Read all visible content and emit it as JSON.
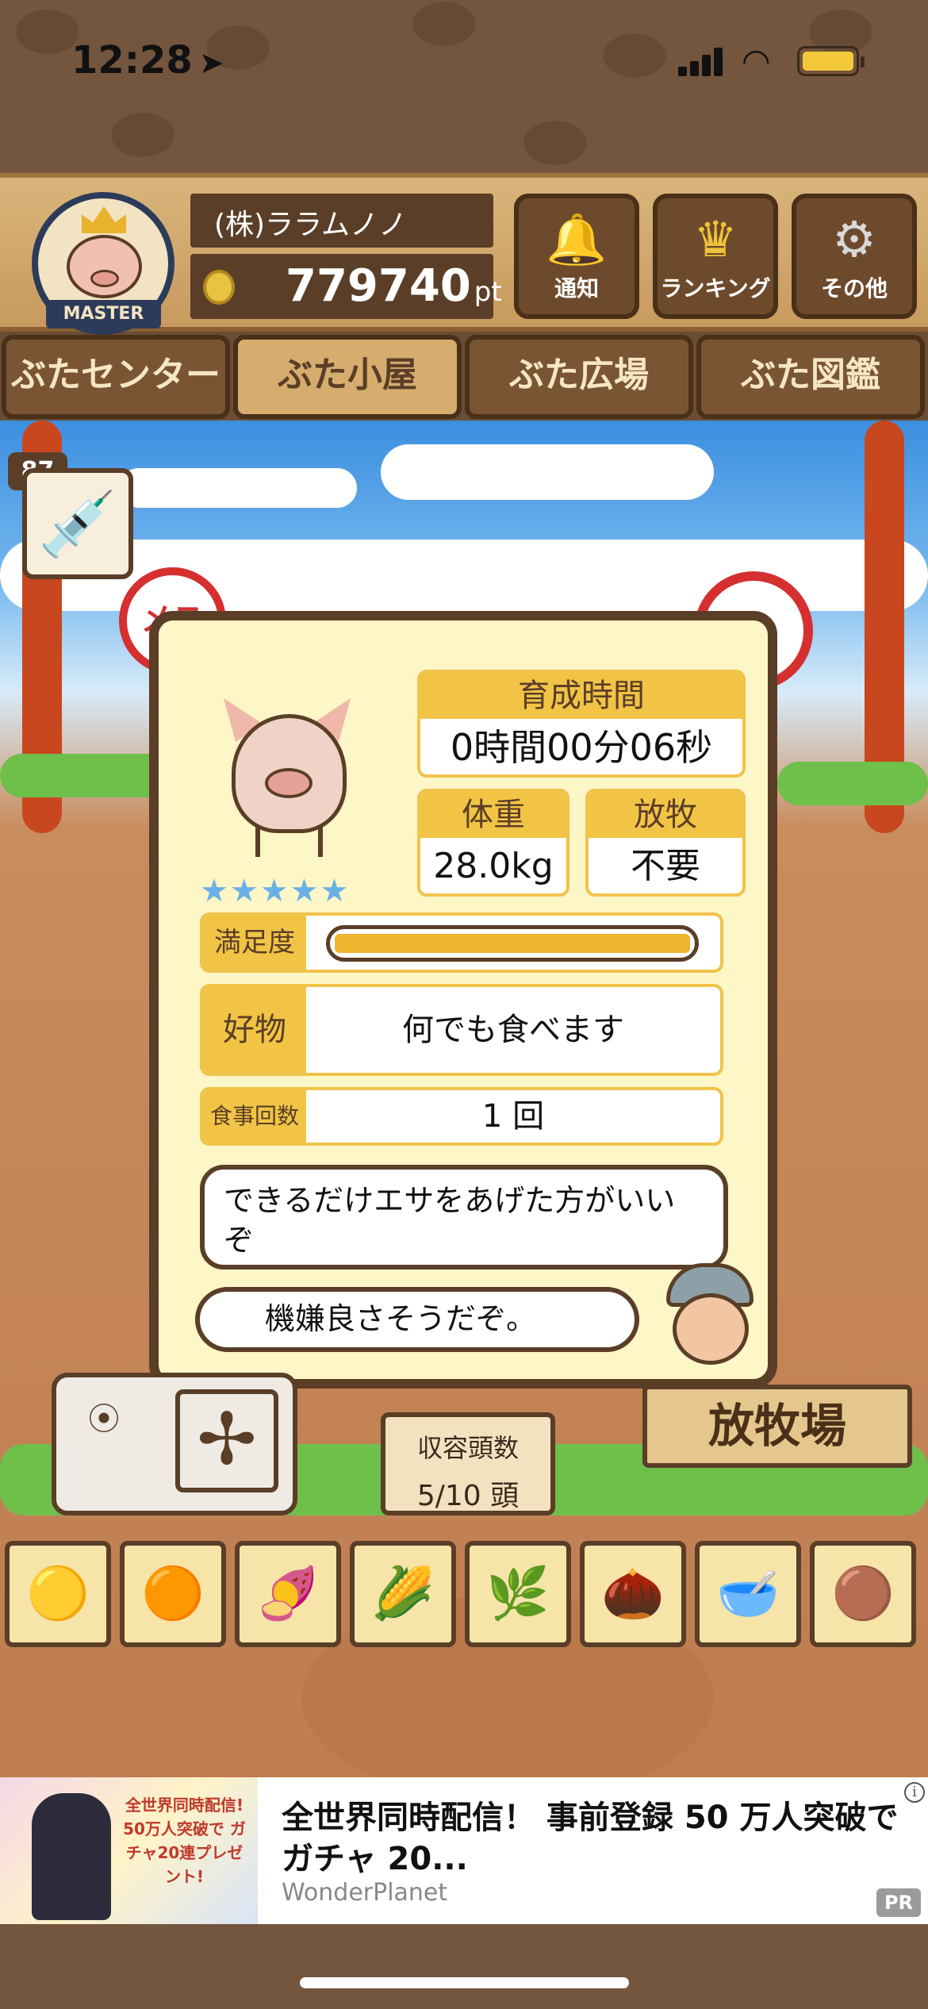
{
  "status": {
    "time": "12:28",
    "location_icon": "location-arrow-icon"
  },
  "header": {
    "badge_label": "MASTER",
    "company_name": "(株)ララムノノ",
    "points": "779740",
    "points_unit": "pt",
    "buttons": [
      {
        "label": "通知",
        "icon": "bell-icon"
      },
      {
        "label": "ランキング",
        "icon": "crown-icon"
      },
      {
        "label": "その他",
        "icon": "gear-icon"
      }
    ]
  },
  "tabs": [
    {
      "label": "ぶたセンター",
      "active": false
    },
    {
      "label": "ぶた小屋",
      "active": true
    },
    {
      "label": "ぶた広場",
      "active": false
    },
    {
      "label": "ぶた図鑑",
      "active": false
    }
  ],
  "syringe_count": "87",
  "sex_label": "メス",
  "pig": {
    "stars": "★★★★★",
    "rearing_time_header": "育成時間",
    "rearing_time_value": "0時間00分06秒",
    "weight_header": "体重",
    "weight_value": "28.0kg",
    "grazing_header": "放牧",
    "grazing_value": "不要",
    "satisfaction_label": "満足度",
    "satisfaction_level": 1.0,
    "favorite_label": "好物",
    "favorite_value": "何でも食べます",
    "meals_label": "食事回数",
    "meals_value": "1 回",
    "advice": "できるだけエサをあげた方がいいぞ",
    "mood": "機嫌良さそうだぞ。"
  },
  "scene": {
    "capacity_title": "収容頭数",
    "capacity_value": "5/10 頭",
    "pasture_sign": "放牧場"
  },
  "food_items": [
    "🟡",
    "🟠",
    "🍠",
    "🌽",
    "🌿",
    "🌰",
    "🥣",
    "🟤"
  ],
  "ad": {
    "promo_text": "全世界同時配信! 50万人突破で ガチャ20連プレゼント!",
    "title": "全世界同時配信！ 事前登録 50 万人突破でガチャ 20...",
    "brand": "WonderPlanet",
    "badge": "PR",
    "info": "i"
  }
}
